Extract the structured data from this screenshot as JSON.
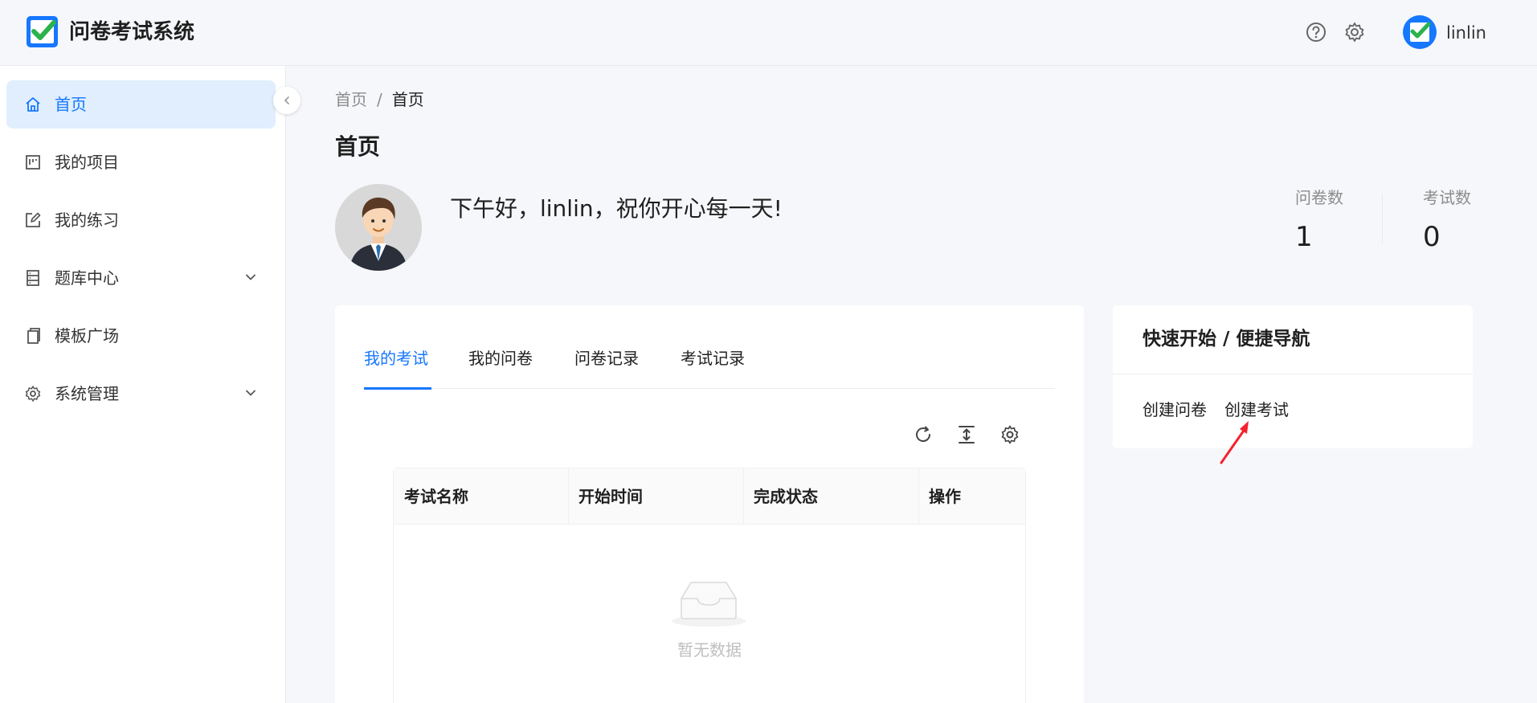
{
  "header": {
    "app_title": "问卷考试系统",
    "user_name": "linlin",
    "icons": [
      "help-icon",
      "gear-icon"
    ]
  },
  "sidebar": {
    "items": [
      {
        "label": "首页",
        "icon": "home-icon",
        "active": true
      },
      {
        "label": "我的项目",
        "icon": "project-icon"
      },
      {
        "label": "我的练习",
        "icon": "edit-icon"
      },
      {
        "label": "题库中心",
        "icon": "database-icon",
        "expandable": true
      },
      {
        "label": "模板广场",
        "icon": "copy-icon"
      },
      {
        "label": "系统管理",
        "icon": "gear-icon",
        "expandable": true
      }
    ]
  },
  "breadcrumb": {
    "root": "首页",
    "separator": "/",
    "current": "首页"
  },
  "page_title": "首页",
  "greeting": "下午好，linlin，祝你开心每一天!",
  "stats": [
    {
      "label": "问卷数",
      "value": "1"
    },
    {
      "label": "考试数",
      "value": "0"
    }
  ],
  "tabs": [
    "我的考试",
    "我的问卷",
    "问卷记录",
    "考试记录"
  ],
  "table": {
    "columns": [
      "考试名称",
      "开始时间",
      "完成状态",
      "操作"
    ],
    "empty_text": "暂无数据",
    "toolbar_icons": [
      "reload-icon",
      "column-height-icon",
      "setting-icon"
    ]
  },
  "quick_start": {
    "title": "快速开始 / 便捷导航",
    "links": [
      "创建问卷",
      "创建考试"
    ]
  },
  "colors": {
    "primary": "#1677ff",
    "active_bg": "#e0eefd",
    "logo_green": "#2bb24c",
    "arrow_red": "#f5222d"
  }
}
